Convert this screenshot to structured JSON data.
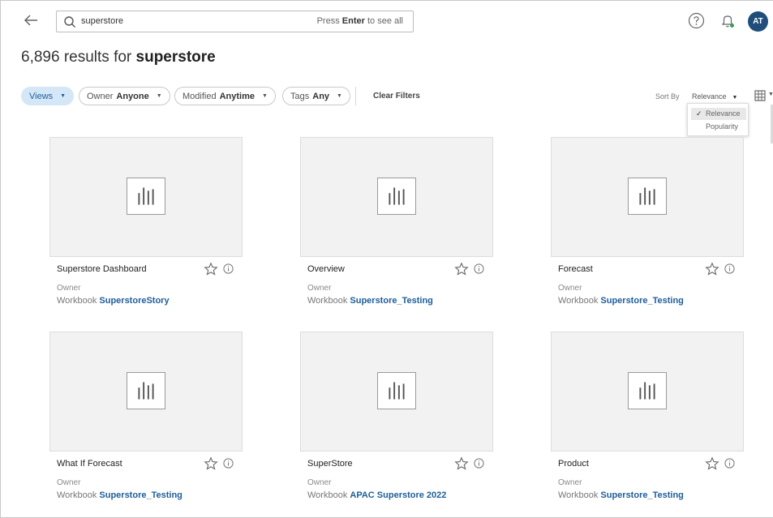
{
  "search": {
    "query": "superstore",
    "hint_prefix": "Press",
    "hint_key": "Enter",
    "hint_suffix": "to see all"
  },
  "user": {
    "initials": "AT"
  },
  "results": {
    "count": "6,896",
    "label": "results for",
    "term": "superstore"
  },
  "filters": [
    {
      "label": "Views",
      "value": ""
    },
    {
      "label": "Owner",
      "value": "Anyone"
    },
    {
      "label": "Modified",
      "value": "Anytime"
    },
    {
      "label": "Tags",
      "value": "Any"
    }
  ],
  "clear_filters": "Clear Filters",
  "sort": {
    "label": "Sort By",
    "selected": "Relevance",
    "options": [
      "Relevance",
      "Popularity"
    ]
  },
  "cards": [
    {
      "title": "Superstore Dashboard",
      "owner_label": "Owner",
      "workbook_label": "Workbook",
      "workbook": "SuperstoreStory"
    },
    {
      "title": "Overview",
      "owner_label": "Owner",
      "workbook_label": "Workbook",
      "workbook": "Superstore_Testing"
    },
    {
      "title": "Forecast",
      "owner_label": "Owner",
      "workbook_label": "Workbook",
      "workbook": "Superstore_Testing"
    },
    {
      "title": "What If Forecast",
      "owner_label": "Owner",
      "workbook_label": "Workbook",
      "workbook": "Superstore_Testing"
    },
    {
      "title": "SuperStore",
      "owner_label": "Owner",
      "workbook_label": "Workbook",
      "workbook": "APAC Superstore 2022"
    },
    {
      "title": "Product",
      "owner_label": "Owner",
      "workbook_label": "Workbook",
      "workbook": "Superstore_Testing"
    }
  ],
  "colors": {
    "accent": "#1e5e9a",
    "avatar": "#1f4e7a",
    "active_chip": "#d4e7f7",
    "thumb_bg": "#f2f2f2"
  }
}
